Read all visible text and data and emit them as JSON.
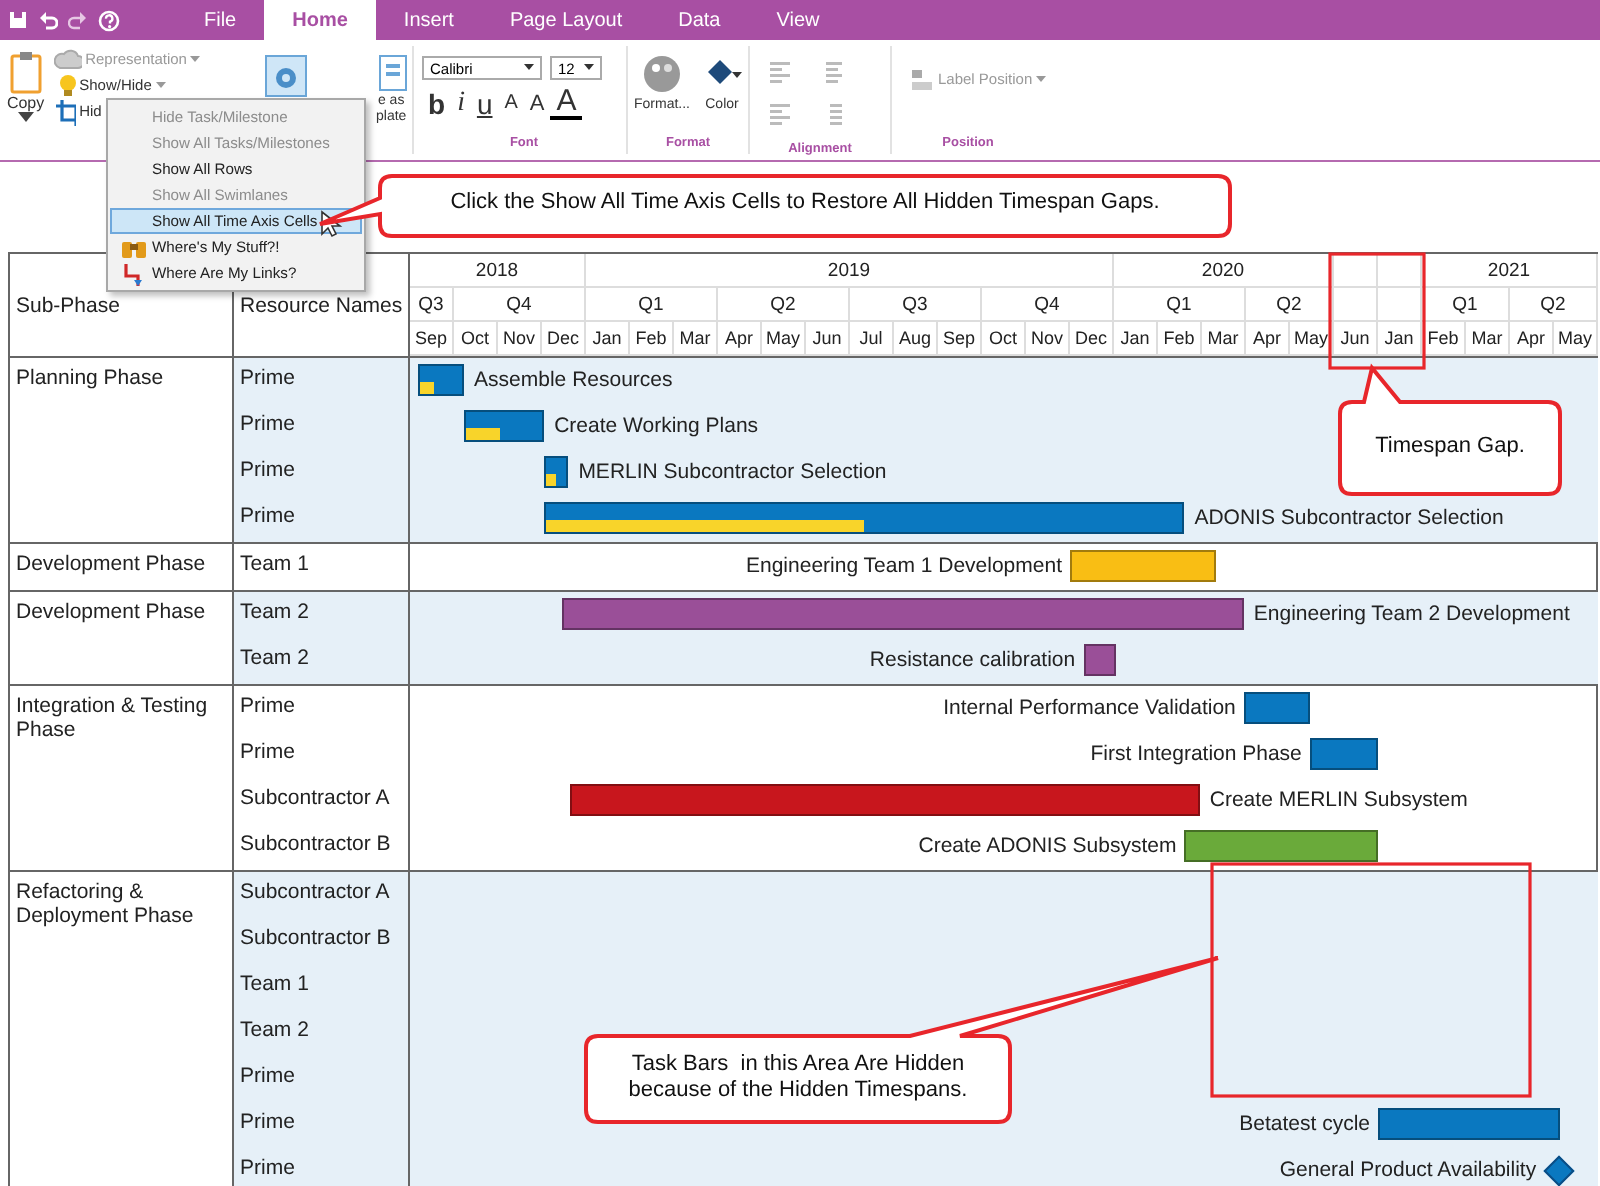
{
  "tabs": [
    {
      "label": "File",
      "selected": false
    },
    {
      "label": "Home",
      "selected": true
    },
    {
      "label": "Insert",
      "selected": false
    },
    {
      "label": "Page Layout",
      "selected": false
    },
    {
      "label": "Data",
      "selected": false
    },
    {
      "label": "View",
      "selected": false
    }
  ],
  "ribbon": {
    "copy": "Copy",
    "small_buttons": [
      {
        "label": "Representation",
        "kind": "representation",
        "disabled": true
      },
      {
        "label": "Show/Hide",
        "kind": "bulb",
        "disabled": false
      },
      {
        "label": "Hid",
        "kind": "crop",
        "disabled": false
      }
    ],
    "template_label": "e as\nplate",
    "font_name": "Calibri",
    "font_size": "12",
    "font_buttons": [
      {
        "text": "b",
        "kind": "bold"
      },
      {
        "text": "i",
        "kind": "italic"
      },
      {
        "text": "u",
        "kind": "underline"
      },
      {
        "text": "A",
        "kind": "grow"
      },
      {
        "text": "A",
        "kind": "shrink"
      },
      {
        "text": "A",
        "kind": "color"
      }
    ],
    "format_label": "Format...",
    "color_label": "Color",
    "label_position": {
      "label": "Label Position",
      "disabled": true
    },
    "group_labels": [
      "Font",
      "Format",
      "Alignment",
      "Position"
    ]
  },
  "menu": {
    "items": [
      {
        "label": "Hide Task/Milestone",
        "kind": "plain",
        "disabled": true,
        "selected": false
      },
      {
        "label": "Show All Tasks/Milestones",
        "kind": "plain",
        "disabled": true,
        "selected": false
      },
      {
        "label": "Show All Rows",
        "kind": "plain",
        "disabled": false,
        "selected": false
      },
      {
        "label": "Show All Swimlanes",
        "kind": "plain",
        "disabled": true,
        "selected": false
      },
      {
        "label": "Show All Time Axis Cells",
        "kind": "plain",
        "disabled": false,
        "selected": true
      },
      {
        "label": "Where's My Stuff?!",
        "kind": "binoculars",
        "disabled": false,
        "selected": false
      },
      {
        "label": "Where Are My Links?",
        "kind": "link",
        "disabled": false,
        "selected": false
      }
    ]
  },
  "callouts": [
    {
      "text": "Click the Show All Time Axis Cells to Restore All Hidden Timespan Gaps."
    },
    {
      "text": "Timespan Gap."
    },
    {
      "text": "Task Bars  in this Area Are Hidden because of the Hidden Timespans."
    }
  ],
  "gantt": {
    "columns": [
      "Sub-Phase",
      "Resource Names"
    ],
    "time_axis": [
      {
        "kind": "year",
        "label": "2018",
        "quarters": [
          {
            "label": "Q3",
            "months": [
              "Sep"
            ]
          },
          {
            "label": "Q4",
            "months": [
              "Oct",
              "Nov",
              "Dec"
            ]
          }
        ]
      },
      {
        "kind": "year",
        "label": "2019",
        "quarters": [
          {
            "label": "Q1",
            "months": [
              "Jan",
              "Feb",
              "Mar"
            ]
          },
          {
            "label": "Q2",
            "months": [
              "Apr",
              "May",
              "Jun"
            ]
          },
          {
            "label": "Q3",
            "months": [
              "Jul",
              "Aug",
              "Sep"
            ]
          },
          {
            "label": "Q4",
            "months": [
              "Oct",
              "Nov",
              "Dec"
            ]
          }
        ]
      },
      {
        "kind": "year",
        "label": "2020",
        "quarters": [
          {
            "label": "Q1",
            "months": [
              "Jan",
              "Feb",
              "Mar"
            ]
          },
          {
            "label": "Q2",
            "months": [
              "Apr",
              "May"
            ]
          }
        ]
      },
      {
        "kind": "gap",
        "months": [
          "Jun"
        ]
      },
      {
        "kind": "gap",
        "months": [
          "Jan"
        ]
      },
      {
        "kind": "year",
        "label": "2021",
        "quarters": [
          {
            "label": "Q1",
            "months": [
              "Feb",
              "Mar"
            ]
          },
          {
            "label": "Q2",
            "months": [
              "Apr",
              "May"
            ]
          }
        ]
      }
    ],
    "groups": [
      {
        "sub_phase": "Planning Phase",
        "shaded": true,
        "rows": [
          {
            "resource": "Prime",
            "task": {
              "name": "Assemble Resources",
              "kind": "bar",
              "color": "#0a78c0",
              "level": 0.35,
              "label_left": false
            }
          },
          {
            "resource": "Prime",
            "task": {
              "name": "Create Working Plans",
              "kind": "bar",
              "color": "#0a78c0",
              "level": 0.45,
              "label_left": false
            }
          },
          {
            "resource": "Prime",
            "task": {
              "name": "MERLIN Subcontractor Selection",
              "kind": "bar",
              "color": "#0a78c0",
              "level": 0.5,
              "label_left": false
            }
          },
          {
            "resource": "Prime",
            "task": {
              "name": "ADONIS Subcontractor Selection",
              "kind": "bar",
              "color": "#0a78c0",
              "level": 0.5,
              "label_left": false
            }
          }
        ]
      },
      {
        "sub_phase": "Development Phase",
        "shaded": false,
        "rows": [
          {
            "resource": "Team 1",
            "task": {
              "name": "Engineering Team 1 Development",
              "kind": "bar",
              "color": "#f9be14",
              "label_left": true
            }
          }
        ]
      },
      {
        "sub_phase": "Development Phase",
        "shaded": true,
        "rows": [
          {
            "resource": "Team 2",
            "task": {
              "name": "Engineering Team 2 Development",
              "kind": "bar",
              "color": "#9a4f98",
              "label_left": false
            }
          },
          {
            "resource": "Team 2",
            "task": {
              "name": "Resistance calibration",
              "kind": "bar",
              "color": "#9a4f98",
              "label_left": true
            }
          }
        ]
      },
      {
        "sub_phase": "Integration & Testing Phase",
        "shaded": false,
        "rows": [
          {
            "resource": "Prime",
            "task": {
              "name": "Internal Performance Validation",
              "kind": "bar",
              "color": "#0a78c0",
              "label_left": true
            }
          },
          {
            "resource": "Prime",
            "task": {
              "name": "First Integration Phase",
              "kind": "bar",
              "color": "#0a78c0",
              "label_left": true
            }
          },
          {
            "resource": "Subcontractor A",
            "task": {
              "name": "Create MERLIN Subsystem",
              "kind": "bar",
              "color": "#c8161d",
              "label_left": false
            }
          },
          {
            "resource": "Subcontractor B",
            "task": {
              "name": "Create ADONIS Subsystem",
              "kind": "bar",
              "color": "#6aaa3a",
              "label_left": true
            }
          }
        ]
      },
      {
        "sub_phase": "Refactoring & Deployment Phase",
        "shaded": true,
        "rows": [
          {
            "resource": "Subcontractor A"
          },
          {
            "resource": "Subcontractor B"
          },
          {
            "resource": "Team 1"
          },
          {
            "resource": "Team 2"
          },
          {
            "resource": "Prime"
          },
          {
            "resource": "Prime",
            "task": {
              "name": "Betatest cycle",
              "kind": "bar",
              "color": "#0a78c0",
              "label_left": true
            }
          },
          {
            "resource": "Prime",
            "task": {
              "name": "General Product Availability",
              "kind": "milestone",
              "color": "#0a78c0",
              "label_left": true
            }
          }
        ]
      }
    ]
  }
}
